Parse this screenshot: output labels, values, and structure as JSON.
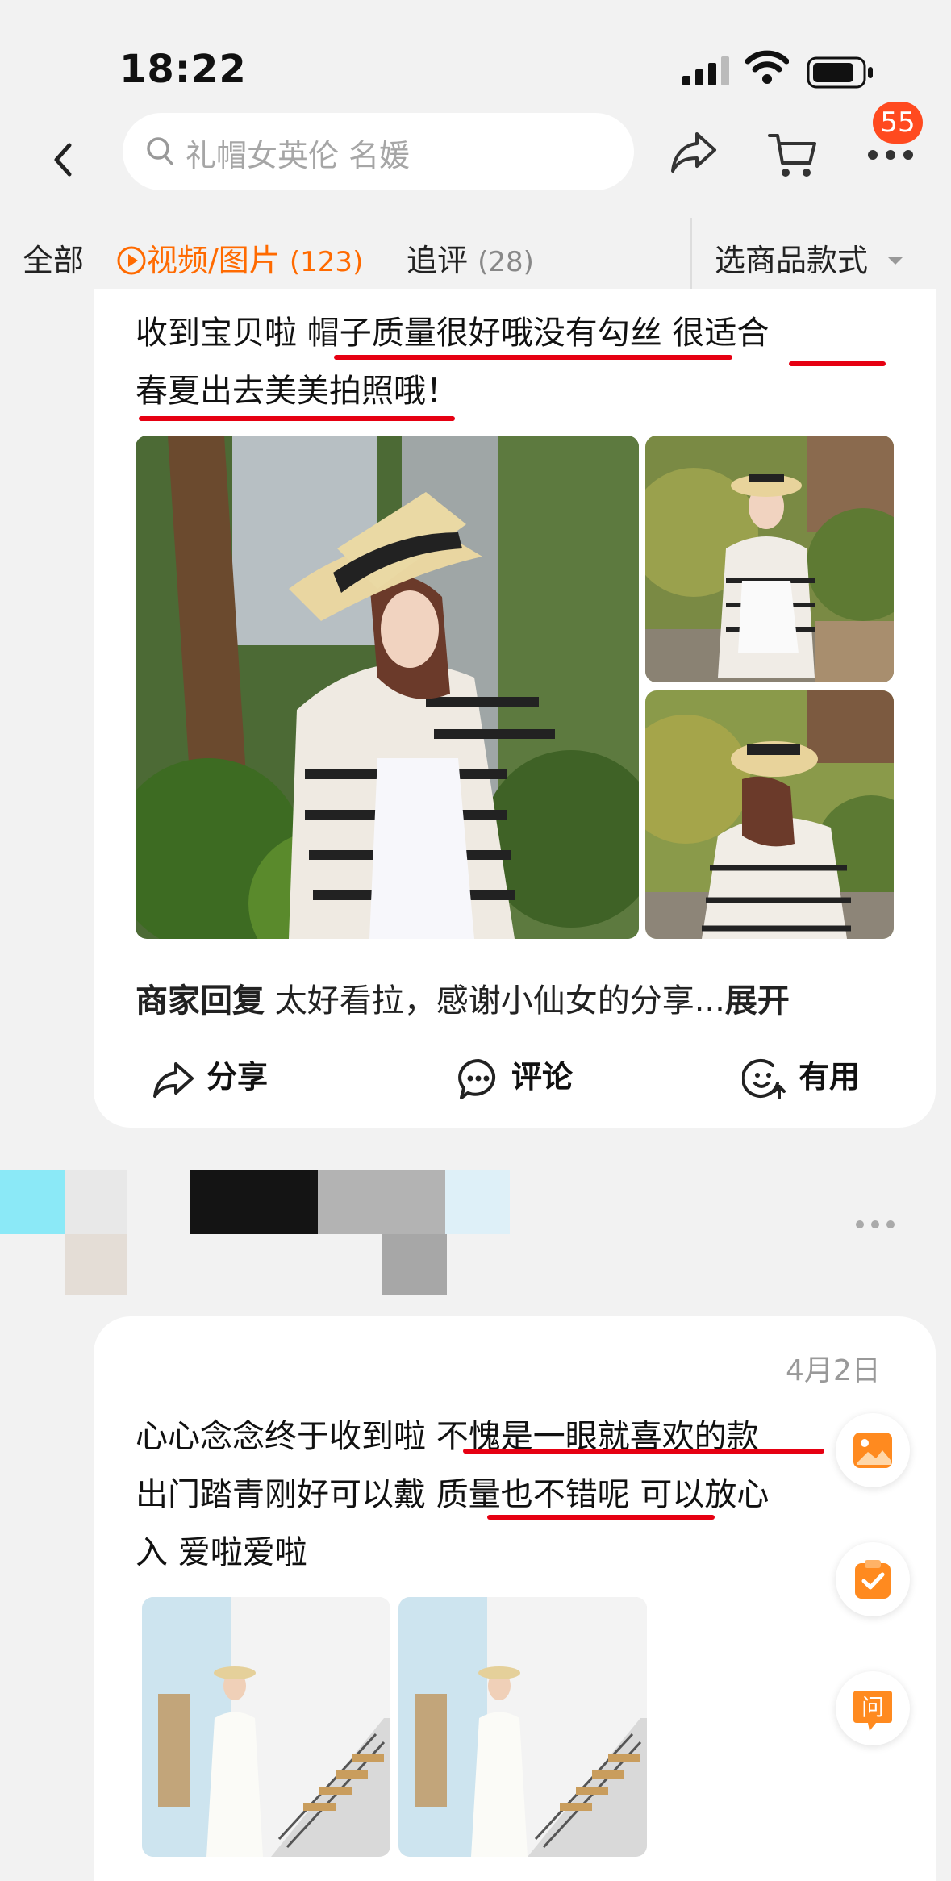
{
  "status": {
    "time": "18:22"
  },
  "nav": {
    "search_placeholder": "礼帽女英伦 名媛",
    "cart_badge": "55"
  },
  "tabs": {
    "all": "全部",
    "media_label": "视频/图片",
    "media_count": "(123)",
    "followup_label": "追评",
    "followup_count": "(28)",
    "variant": "选商品款式"
  },
  "review1": {
    "line1": "收到宝贝啦 帽子质量很好哦没有勾丝 很适合",
    "line2": "春夏出去美美拍照哦！",
    "reply_label": "商家回复",
    "reply_text": "太好看拉，感谢小仙女的分享...",
    "reply_expand": "展开",
    "actions": {
      "share": "分享",
      "comment": "评论",
      "useful": "有用"
    }
  },
  "review2": {
    "date": "4月2日",
    "line1": "心心念念终于收到啦 不愧是一眼就喜欢的款",
    "line2": "出门踏青刚好可以戴 质量也不错呢 可以放心",
    "line3": "入 爱啦爱啦"
  },
  "floating": {
    "ask_label": "问"
  },
  "colors": {
    "accent": "#ff6a00",
    "underline": "#e60012",
    "badge": "#ff4a1f"
  }
}
